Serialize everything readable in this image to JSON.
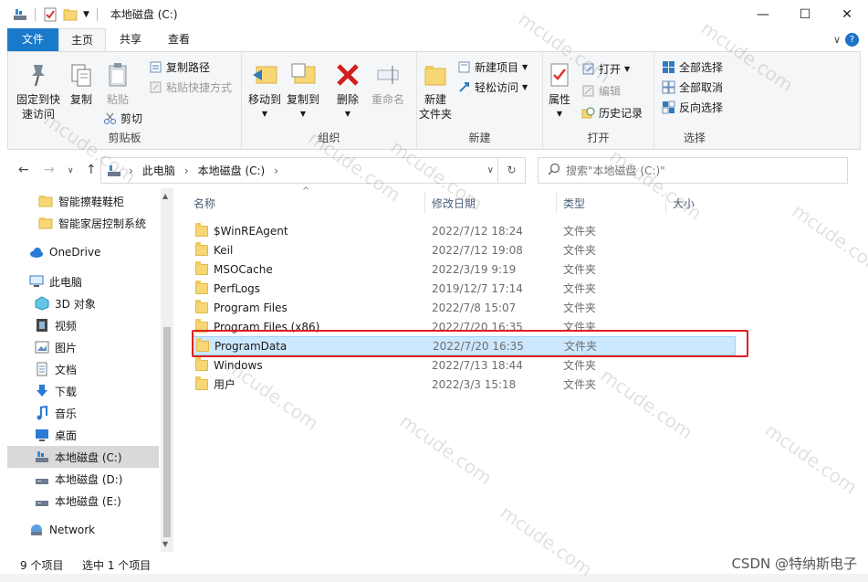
{
  "window": {
    "title": "本地磁盘 (C:)",
    "controls": {
      "minimize": "—",
      "maximize": "☐",
      "close": "✕"
    }
  },
  "tabs": [
    {
      "label": "文件"
    },
    {
      "label": "主页"
    },
    {
      "label": "共享"
    },
    {
      "label": "查看"
    }
  ],
  "ribbon": {
    "clipboard": {
      "label": "剪贴板",
      "pin": "固定到快\n速访问",
      "pin_line1": "固定到快",
      "pin_line2": "速访问",
      "copy": "复制",
      "paste": "粘贴",
      "copy_path": "复制路径",
      "paste_shortcut": "粘贴快捷方式",
      "cut": "剪切"
    },
    "organize": {
      "label": "组织",
      "move_to": "移动到",
      "copy_to": "复制到",
      "delete": "删除",
      "rename": "重命名"
    },
    "new": {
      "label": "新建",
      "new_item": "新建项目",
      "easy_access": "轻松访问",
      "new_folder_line1": "新建",
      "new_folder_line2": "文件夹"
    },
    "open": {
      "label": "打开",
      "properties": "属性",
      "open": "打开",
      "edit": "编辑",
      "history": "历史记录"
    },
    "select": {
      "label": "选择",
      "select_all": "全部选择",
      "select_none": "全部取消",
      "invert": "反向选择"
    }
  },
  "address": {
    "crumbs": [
      "此电脑",
      "本地磁盘 (C:)"
    ],
    "search_placeholder": "搜索\"本地磁盘 (C:)\""
  },
  "nav": {
    "items": [
      {
        "label": "智能擦鞋鞋柜",
        "icon": "folder-icon"
      },
      {
        "label": "智能家居控制系统",
        "icon": "folder-icon"
      },
      {
        "label": "OneDrive",
        "icon": "cloud-icon"
      },
      {
        "label": "此电脑",
        "icon": "computer-icon"
      },
      {
        "label": "3D 对象",
        "icon": "cube-icon"
      },
      {
        "label": "视频",
        "icon": "video-icon"
      },
      {
        "label": "图片",
        "icon": "picture-icon"
      },
      {
        "label": "文档",
        "icon": "document-icon"
      },
      {
        "label": "下载",
        "icon": "download-icon"
      },
      {
        "label": "音乐",
        "icon": "music-icon"
      },
      {
        "label": "桌面",
        "icon": "desktop-icon"
      },
      {
        "label": "本地磁盘 (C:)",
        "icon": "drive-icon"
      },
      {
        "label": "本地磁盘 (D:)",
        "icon": "drive-icon"
      },
      {
        "label": "本地磁盘 (E:)",
        "icon": "drive-icon"
      },
      {
        "label": "Network",
        "icon": "network-icon"
      }
    ]
  },
  "columns": {
    "name": "名称",
    "date": "修改日期",
    "type": "类型",
    "size": "大小"
  },
  "files": [
    {
      "name": "$WinREAgent",
      "date": "2022/7/12 18:24",
      "type": "文件夹"
    },
    {
      "name": "Keil",
      "date": "2022/7/12 19:08",
      "type": "文件夹"
    },
    {
      "name": "MSOCache",
      "date": "2022/3/19 9:19",
      "type": "文件夹"
    },
    {
      "name": "PerfLogs",
      "date": "2019/12/7 17:14",
      "type": "文件夹"
    },
    {
      "name": "Program Files",
      "date": "2022/7/8 15:07",
      "type": "文件夹"
    },
    {
      "name": "Program Files (x86)",
      "date": "2022/7/20 16:35",
      "type": "文件夹"
    },
    {
      "name": "ProgramData",
      "date": "2022/7/20 16:35",
      "type": "文件夹"
    },
    {
      "name": "Windows",
      "date": "2022/7/13 18:44",
      "type": "文件夹"
    },
    {
      "name": "用户",
      "date": "2022/3/3 15:18",
      "type": "文件夹"
    }
  ],
  "status": {
    "count": "9 个项目",
    "selected": "选中 1 个项目"
  },
  "watermark": {
    "text": "mcude.com",
    "credit": "CSDN @特纳斯电子"
  },
  "colors": {
    "accent": "#1979ca",
    "selection": "#cce8ff",
    "highlight_box": "#e02020"
  }
}
